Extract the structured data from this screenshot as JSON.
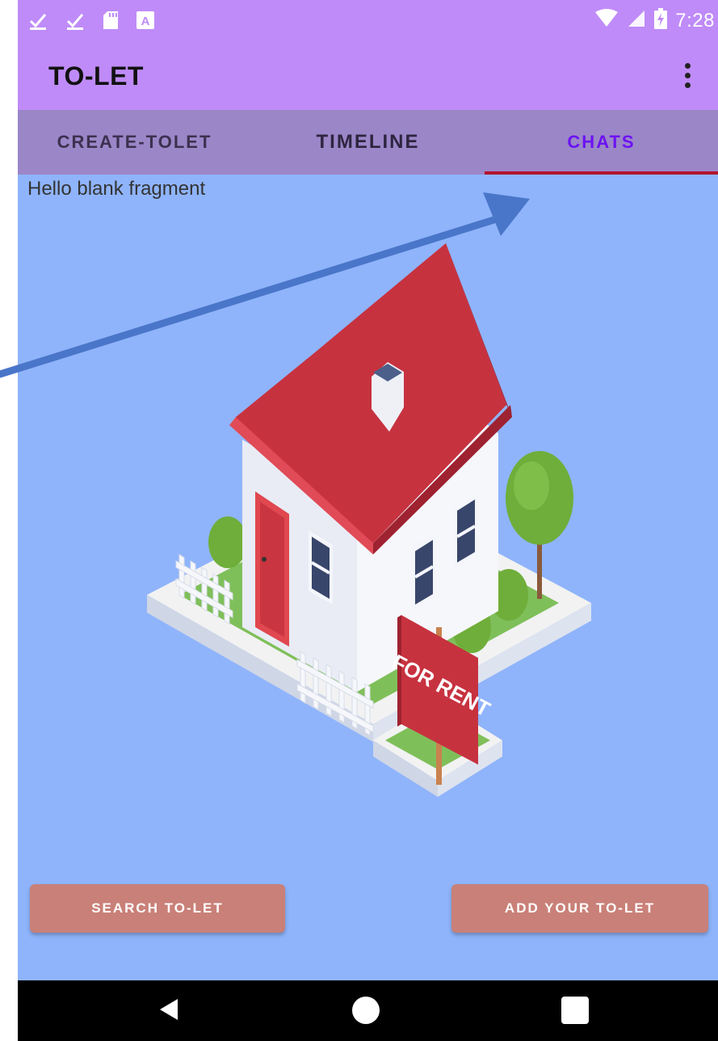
{
  "status_bar": {
    "time": "7:28",
    "icons": [
      "download-done-icon",
      "download-done-icon",
      "sd-card-icon",
      "font-icon",
      "wifi-icon",
      "signal-icon",
      "battery-charging-icon"
    ]
  },
  "app_bar": {
    "title": "TO-LET",
    "menu_icon": "more-vert-icon"
  },
  "tabs": [
    {
      "label": "CREATE-TOLET",
      "active": false
    },
    {
      "label": "TIMELINE",
      "active": false
    },
    {
      "label": "CHATS",
      "active": true
    }
  ],
  "content": {
    "placeholder_text": "Hello blank fragment",
    "illustration": {
      "sign_text": "FOR RENT"
    }
  },
  "buttons": {
    "search_label": "SEARCH TO-LET",
    "add_label": "ADD YOUR TO-LET"
  },
  "nav_bar": {
    "icons": [
      "back-icon",
      "home-icon",
      "recents-icon"
    ]
  },
  "colors": {
    "app_bar": "#bf8bf8",
    "tab_bar": "#9b86c8",
    "active_tab": "#6c12f2",
    "tab_indicator": "#b3132d",
    "background": "#8fb4fb",
    "button": "#c98078",
    "arrow": "#4a76c9"
  }
}
